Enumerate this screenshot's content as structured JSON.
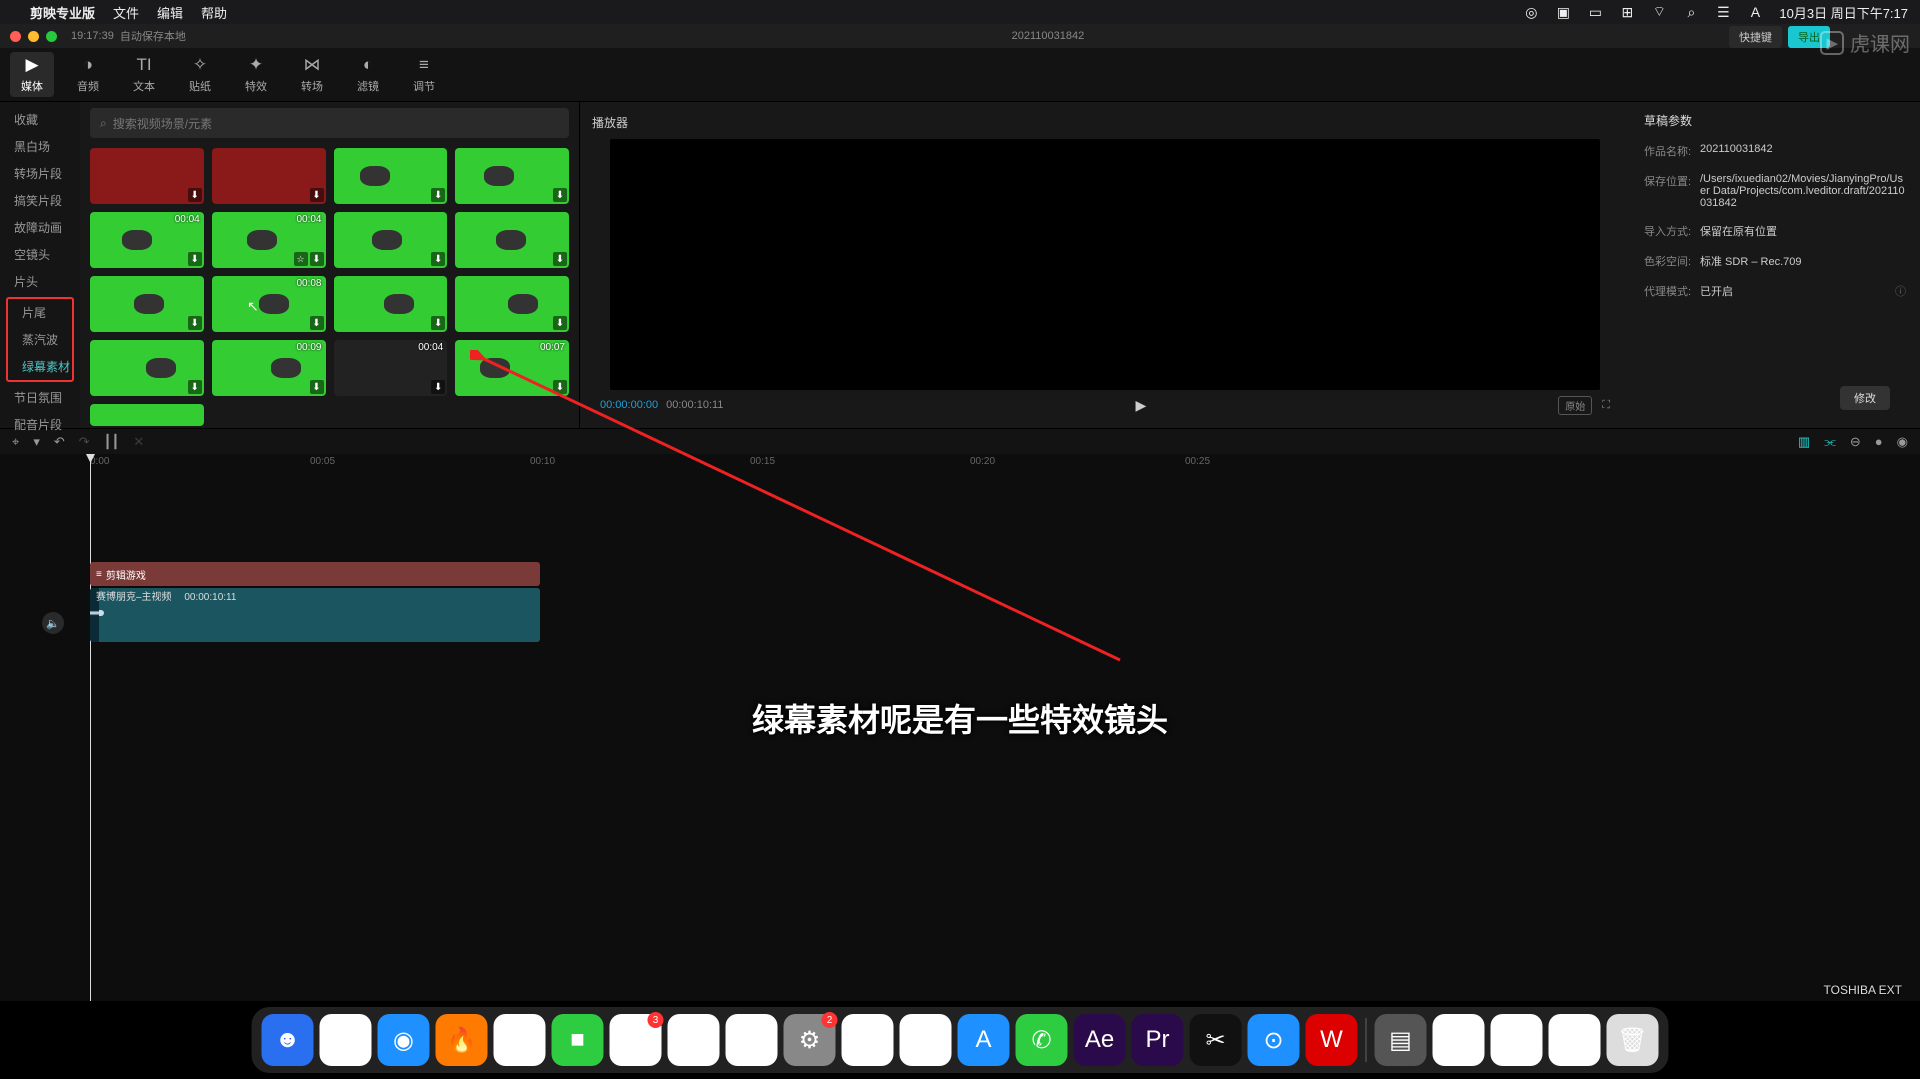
{
  "menubar": {
    "app": "剪映专业版",
    "items": [
      "文件",
      "编辑",
      "帮助"
    ],
    "date": "10月3日 周日下午7:17"
  },
  "titlebar": {
    "time": "19:17:39",
    "status": "自动保存本地",
    "doc": "202110031842"
  },
  "top_right_buttons": {
    "a": "快捷键",
    "b": "导出"
  },
  "tabs": [
    {
      "label": "媒体",
      "icon": "▶"
    },
    {
      "label": "音频",
      "icon": "◑"
    },
    {
      "label": "文本",
      "icon": "TI"
    },
    {
      "label": "贴纸",
      "icon": "✧"
    },
    {
      "label": "特效",
      "icon": "✦"
    },
    {
      "label": "转场",
      "icon": "⋈"
    },
    {
      "label": "滤镜",
      "icon": "◐"
    },
    {
      "label": "调节",
      "icon": "≡"
    }
  ],
  "sidebar": {
    "items": [
      "收藏",
      "黑白场",
      "转场片段",
      "搞笑片段",
      "故障动画",
      "空镜头",
      "片头"
    ],
    "boxed": [
      "片尾",
      "蒸汽波",
      "绿幕素材"
    ],
    "rest": [
      "节日氛围",
      "配音片段"
    ]
  },
  "search": {
    "placeholder": "搜索视频场景/元素"
  },
  "thumbs": [
    {
      "dur": "",
      "cls": "red"
    },
    {
      "dur": "",
      "cls": "red"
    },
    {
      "dur": "",
      "cls": ""
    },
    {
      "dur": "",
      "cls": ""
    },
    {
      "dur": "00:04",
      "cls": ""
    },
    {
      "dur": "00:04",
      "cls": ""
    },
    {
      "dur": "",
      "cls": ""
    },
    {
      "dur": "",
      "cls": ""
    },
    {
      "dur": "",
      "cls": ""
    },
    {
      "dur": "00:08",
      "cls": ""
    },
    {
      "dur": "",
      "cls": ""
    },
    {
      "dur": "",
      "cls": ""
    },
    {
      "dur": "",
      "cls": ""
    },
    {
      "dur": "00:09",
      "cls": ""
    },
    {
      "dur": "00:04",
      "cls": "dark"
    },
    {
      "dur": "00:07",
      "cls": ""
    }
  ],
  "player": {
    "title": "播放器",
    "cur": "00:00:00:00",
    "total": "00:00:10:11",
    "ratio_label": "原始"
  },
  "draft": {
    "title": "草稿参数",
    "props": {
      "name_k": "作品名称:",
      "name_v": "202110031842",
      "path_k": "保存位置:",
      "path_v": "/Users/ixuedian02/Movies/JianyingPro/User Data/Projects/com.lveditor.draft/202110031842",
      "import_k": "导入方式:",
      "import_v": "保留在原有位置",
      "color_k": "色彩空间:",
      "color_v": "标准 SDR – Rec.709",
      "proxy_k": "代理模式:",
      "proxy_v": "已开启"
    },
    "modify": "修改"
  },
  "ruler": [
    "0:00",
    "00:05",
    "00:10",
    "00:15",
    "00:20",
    "00:25"
  ],
  "track": {
    "title_icon": "≡",
    "title": "剪辑游戏",
    "clip": "赛博朋克–主视频",
    "clip_dur": "00:00:10:11"
  },
  "subtitle": "绿幕素材呢是有一些特效镜头",
  "desktop_label": "TOSHIBA EXT",
  "watermark": "虎课网",
  "dock": [
    {
      "bg": "#2a6ff0",
      "t": "☻"
    },
    {
      "bg": "#fff",
      "t": "⊞"
    },
    {
      "bg": "#1e90ff",
      "t": "◉"
    },
    {
      "bg": "#ff7a00",
      "t": "🔥"
    },
    {
      "bg": "#fff",
      "t": "✿"
    },
    {
      "bg": "#2ecc40",
      "t": "■"
    },
    {
      "bg": "#fff",
      "t": "3",
      "badge": "3"
    },
    {
      "bg": "#fff",
      "t": "▭"
    },
    {
      "bg": "#fff",
      "t": "▦"
    },
    {
      "bg": "#888",
      "t": "⚙",
      "badge": "2"
    },
    {
      "bg": "#fff",
      "t": "▮"
    },
    {
      "bg": "#fff",
      "t": "✎"
    },
    {
      "bg": "#1e90ff",
      "t": "A"
    },
    {
      "bg": "#2ecc40",
      "t": "✆"
    },
    {
      "bg": "#2a0a4a",
      "t": "Ae"
    },
    {
      "bg": "#2a0a4a",
      "t": "Pr"
    },
    {
      "bg": "#111",
      "t": "✂"
    },
    {
      "bg": "#1e90ff",
      "t": "⊙"
    },
    {
      "bg": "#d00",
      "t": "W"
    }
  ],
  "dock_right": [
    {
      "bg": "#555",
      "t": "▤"
    },
    {
      "bg": "#fff",
      "t": "▭"
    },
    {
      "bg": "#fff",
      "t": "▭"
    },
    {
      "bg": "#fff",
      "t": "▭"
    },
    {
      "bg": "#ddd",
      "t": "🗑"
    }
  ]
}
